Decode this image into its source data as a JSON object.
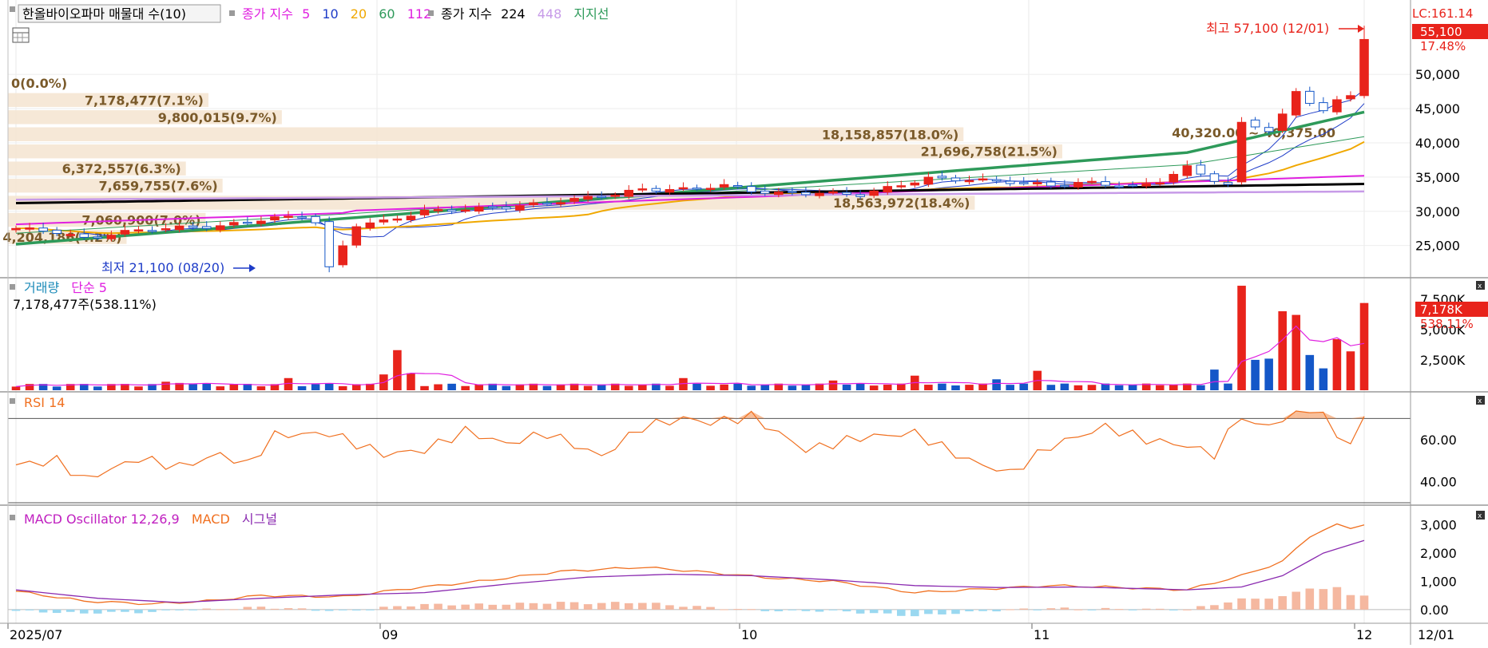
{
  "colors": {
    "up": "#e8231b",
    "down": "#1457c8",
    "ma5": "#1e3cc8",
    "ma10": "#1e3cc8",
    "ma20": "#f0a800",
    "ma60": "#2e9a5a",
    "ma112": "#e020e0",
    "ma224": "#000000",
    "ma448": "#c79be8",
    "support": "#2e9a5a",
    "profile": "#f5e6d3",
    "profile_text": "#7a5a2a",
    "rsi": "#f07020",
    "macd": "#f07020",
    "signal": "#8a2ab0",
    "osc_pos": "#f5b8a0",
    "osc_neg": "#9ad8f0",
    "vol_ma": "#e020e0"
  },
  "price_panel": {
    "title_box": "한올바이오파마 매물대 수(10)",
    "legend1_label": "종가 지수",
    "legend1_periods": [
      "5",
      "10",
      "20",
      "60",
      "112"
    ],
    "legend2_label": "종가 지수",
    "legend2_periods": [
      "224",
      "448"
    ],
    "support_label": "지지선",
    "current_price_label": "55,100",
    "current_change_label": "17.48%",
    "lc_label": "LC:161.14",
    "high_label": "최고 57,100 (12/01)",
    "low_label": "최저 21,100 (08/20)"
  },
  "volume_panel": {
    "title": "거래량",
    "ma_label": "단순 5",
    "current_text": "7,178,477주(538.11%)",
    "badge_value": "7,178K",
    "badge_pct": "538.11%"
  },
  "rsi_panel": {
    "title": "RSI 14"
  },
  "macd_panel": {
    "osc_label": "MACD Oscillator 12,26,9",
    "macd_label": "MACD",
    "signal_label": "시그널"
  },
  "chart_data": {
    "type": "candlestick",
    "x_labels": [
      "2025/07",
      "09",
      "10",
      "11",
      "12",
      "12/01"
    ],
    "price_axis_ticks": [
      "25,000",
      "30,000",
      "35,000",
      "40,000",
      "45,000",
      "50,000"
    ],
    "volume_axis_ticks": [
      "2,500K",
      "5,000K",
      "7,500K"
    ],
    "rsi_axis_ticks": [
      "40.00",
      "60.00"
    ],
    "macd_axis_ticks": [
      "0.00",
      "1,000",
      "2,000",
      "3,000"
    ],
    "volume_profile": [
      {
        "label": "0(0.0%)",
        "share": 0.0
      },
      {
        "label": "7,178,477(7.1%)",
        "share": 7.1
      },
      {
        "label": "9,800,015(9.7%)",
        "share": 9.7
      },
      {
        "label": "18,158,857(18.0%)",
        "share": 18.0
      },
      {
        "label": "21,696,758(21.5%)",
        "share": 21.5
      },
      {
        "label": "6,372,557(6.3%)",
        "share": 6.3
      },
      {
        "label": "7,659,755(7.6%)",
        "share": 7.6
      },
      {
        "label": "18,563,972(18.4%)",
        "share": 18.4
      },
      {
        "label": "7,060,900(7.0%)",
        "share": 7.0
      },
      {
        "label": "4,204,186(4.2%)",
        "share": 4.2
      }
    ],
    "profile_range_label": "40,320.00 ~ 40,375.00",
    "rsi_levels": [
      70,
      30
    ],
    "price_range": [
      21000,
      57600
    ],
    "volume_range": [
      0,
      8800000
    ],
    "rsi_range": [
      30,
      80
    ],
    "macd_range": [
      -400,
      3500
    ]
  }
}
